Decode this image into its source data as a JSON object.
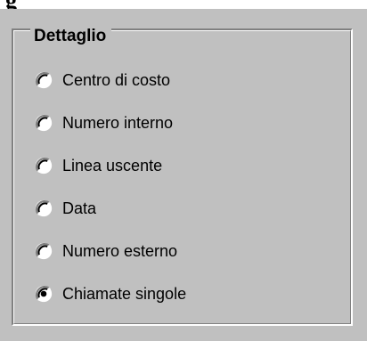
{
  "heading_fragment": "g",
  "group": {
    "title": "Dettaglio",
    "options": [
      {
        "label": "Centro di costo",
        "selected": false
      },
      {
        "label": "Numero interno",
        "selected": false
      },
      {
        "label": "Linea uscente",
        "selected": false
      },
      {
        "label": "Data",
        "selected": false
      },
      {
        "label": "Numero esterno",
        "selected": false
      },
      {
        "label": "Chiamate singole",
        "selected": true
      }
    ]
  },
  "colors": {
    "panel_background": "#c0c0c0",
    "shadow": "#808080",
    "highlight": "#ffffff",
    "text": "#000000"
  },
  "icons": {
    "radio_unselected": "radio-unchecked-icon",
    "radio_selected": "radio-checked-icon"
  }
}
